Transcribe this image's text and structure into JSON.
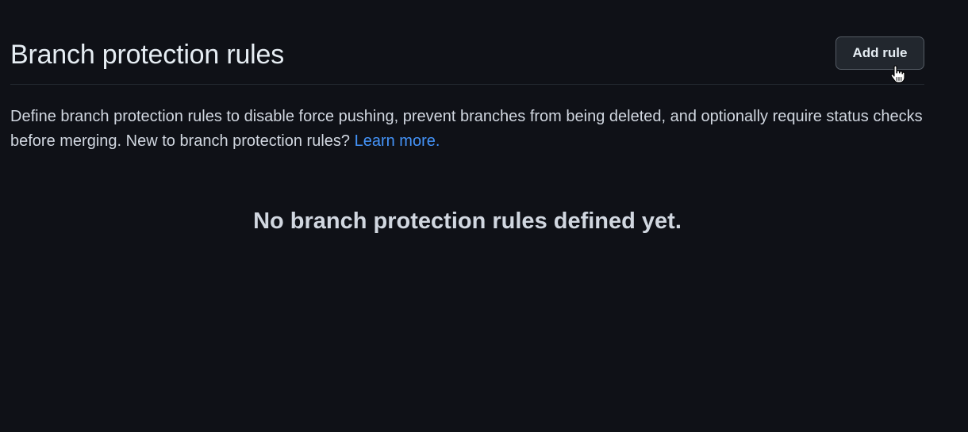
{
  "header": {
    "title": "Branch protection rules",
    "add_rule_label": "Add rule"
  },
  "description": {
    "text": "Define branch protection rules to disable force pushing, prevent branches from being deleted, and optionally require status checks before merging. New to branch protection rules? ",
    "link_label": "Learn more."
  },
  "empty_state": {
    "message": "No branch protection rules defined yet."
  },
  "colors": {
    "background": "#0f1117",
    "link": "#4493f8",
    "button_border": "#545b64"
  },
  "icons": {
    "cursor": "hand-pointer-icon"
  }
}
